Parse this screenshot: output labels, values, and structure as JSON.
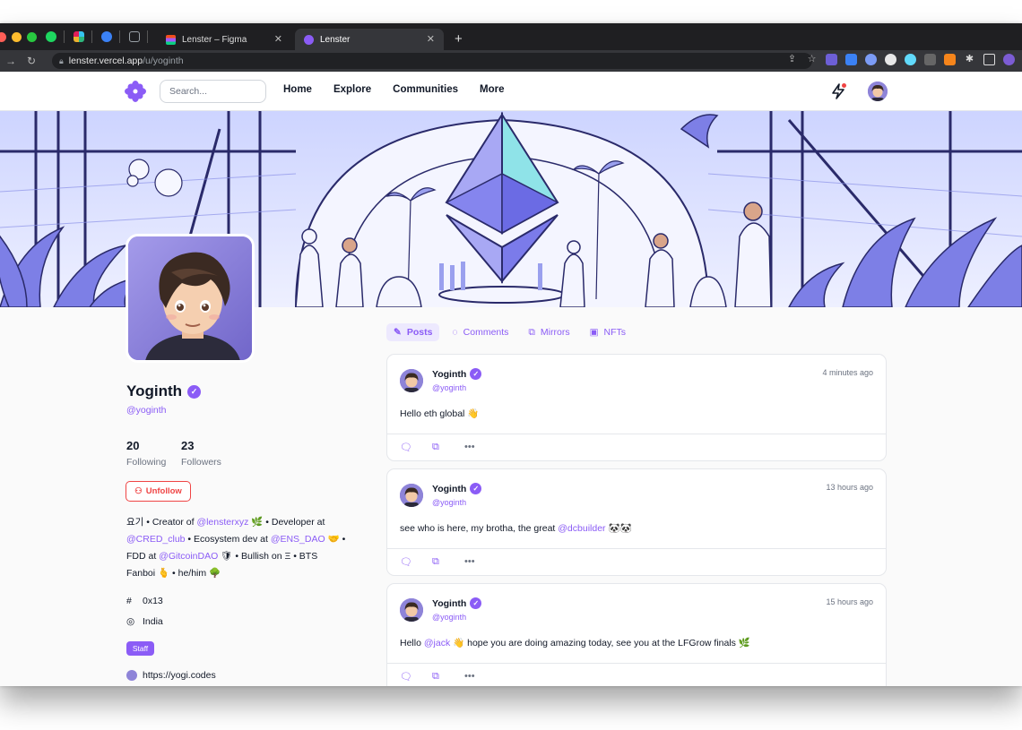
{
  "browser": {
    "tabs": [
      {
        "title": "Lenster – Figma",
        "active": false
      },
      {
        "title": "Lenster",
        "active": true
      }
    ],
    "url_host": "lenster.vercel.app",
    "url_path": "/u/yoginth"
  },
  "header": {
    "search_placeholder": "Search...",
    "nav": [
      "Home",
      "Explore",
      "Communities",
      "More"
    ]
  },
  "profile": {
    "name": "Yoginth",
    "handle": "@yoginth",
    "following_count": "20",
    "following_label": "Following",
    "followers_count": "23",
    "followers_label": "Followers",
    "unfollow_label": "Unfollow",
    "bio": {
      "p1": "요기 • Creator of ",
      "m1": "@lensterxyz",
      "p2": " 🌿 • Developer at ",
      "m2": "@CRED_club",
      "p3": " • Ecosystem dev at ",
      "m3": "@ENS_DAO",
      "p4": " 🤝 • FDD at ",
      "m4": "@GitcoinDAO",
      "p5": " 🛡 • Bullish on Ξ • BTS Fanboi 🫰 • he/him 🌳"
    },
    "hashtag": "0x13",
    "location": "India",
    "staff_label": "Staff",
    "website": "https://yogi.codes"
  },
  "feed_tabs": [
    "Posts",
    "Comments",
    "Mirrors",
    "NFTs"
  ],
  "posts": [
    {
      "author": "Yoginth",
      "handle": "@yoginth",
      "time": "4 minutes ago",
      "text_before": "Hello eth global 👋",
      "mention": "",
      "text_after": ""
    },
    {
      "author": "Yoginth",
      "handle": "@yoginth",
      "time": "13 hours ago",
      "text_before": "see who is here, my brotha, the great ",
      "mention": "@dcbuilder",
      "text_after": " 🐼🐼"
    },
    {
      "author": "Yoginth",
      "handle": "@yoginth",
      "time": "15 hours ago",
      "text_before": "Hello ",
      "mention": "@jack",
      "text_after": " 👋 hope you are doing amazing today, see you at the LFGrow finals 🌿"
    }
  ],
  "colors": {
    "accent": "#8b5cf6",
    "danger": "#ef4444"
  }
}
